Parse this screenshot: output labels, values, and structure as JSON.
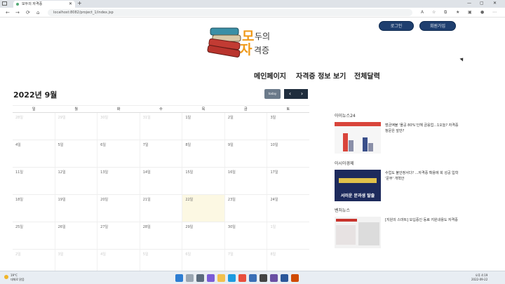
{
  "browser": {
    "tab_title": "모두의 자격증",
    "new_tab": "+",
    "back": "←",
    "forward": "→",
    "reload": "⟳",
    "home": "⌂",
    "url": "localhost:8082/project_1/index.jsp",
    "window_controls": [
      "—",
      "▢",
      "✕"
    ]
  },
  "header": {
    "brand_mo": "모",
    "brand_du": "두의",
    "brand_ji": "자",
    "brand_gj": "격증",
    "login_label": "로그인",
    "signup_label": "회원가입"
  },
  "menu": {
    "items": [
      "메인페이지",
      "자격증 정보 보기",
      "전체달력"
    ]
  },
  "calendar": {
    "title": "2022년 9월",
    "today_label": "today",
    "prev_label": "‹",
    "next_label": "›",
    "weekdays": [
      "일",
      "월",
      "화",
      "수",
      "목",
      "금",
      "토"
    ],
    "weeks": [
      [
        "28일",
        "29일",
        "30일",
        "31일",
        "1일",
        "2일",
        "3일"
      ],
      [
        "4일",
        "5일",
        "6일",
        "7일",
        "8일",
        "9일",
        "10일"
      ],
      [
        "11일",
        "12일",
        "13일",
        "14일",
        "15일",
        "16일",
        "17일"
      ],
      [
        "18일",
        "19일",
        "20일",
        "21일",
        "22일",
        "23일",
        "24일"
      ],
      [
        "25일",
        "26일",
        "27일",
        "28일",
        "29일",
        "30일",
        "1일"
      ],
      [
        "2일",
        "3일",
        "4일",
        "5일",
        "6일",
        "7일",
        "8일"
      ]
    ]
  },
  "news": [
    {
      "category": "아이뉴스24",
      "headline": "범금액불 '몰공 80%'인해 금융업...1오늘? 자격증 청문은 앞만?",
      "thumb_text": "",
      "thumb_color": "#d9453b"
    },
    {
      "category": "아시아경제",
      "headline": "수업도 불안정서다? ...자격증 확용에 희 성공 입학 '문부' 개혁안",
      "thumb_text": "서러운 문과생 탈출",
      "thumb_color": "#1d2a5c"
    },
    {
      "category": "벤처뉴스",
      "headline": "[지원의 스마트] 모십증인 등료 지원내용도 자격증",
      "thumb_text": "",
      "thumb_color": "#c8332c"
    }
  ],
  "taskbar": {
    "weather_temp": "19°C",
    "weather_desc": "대체로 맑음",
    "time": "오후 4:19",
    "date": "2022-09-22"
  }
}
